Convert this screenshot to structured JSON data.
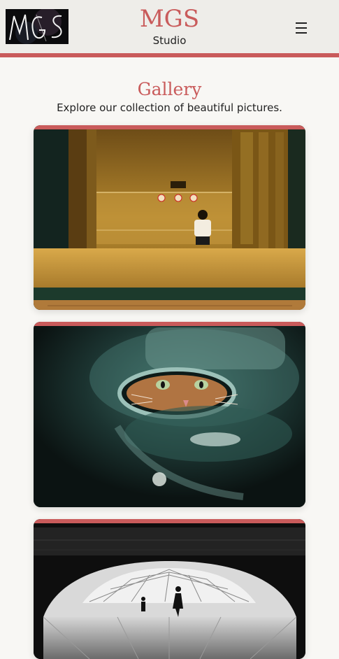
{
  "header": {
    "brand_name": "MGS",
    "brand_sub": "Studio",
    "logo_text": "MGS",
    "menu_icon": "hamburger-icon"
  },
  "gallery": {
    "title": "Gallery",
    "subtitle": "Explore our collection of beautiful pictures."
  },
  "photos": [
    {
      "subject": "person waiting in amber-lit station",
      "sign_text": "銀座駅"
    },
    {
      "subject": "cat peering through helmet visor"
    },
    {
      "subject": "silhouettes under lattice dome, black and white"
    }
  ],
  "colors": {
    "accent": "#c95b5b",
    "header_bg": "#eeede9",
    "page_bg": "#f8f7f4"
  }
}
